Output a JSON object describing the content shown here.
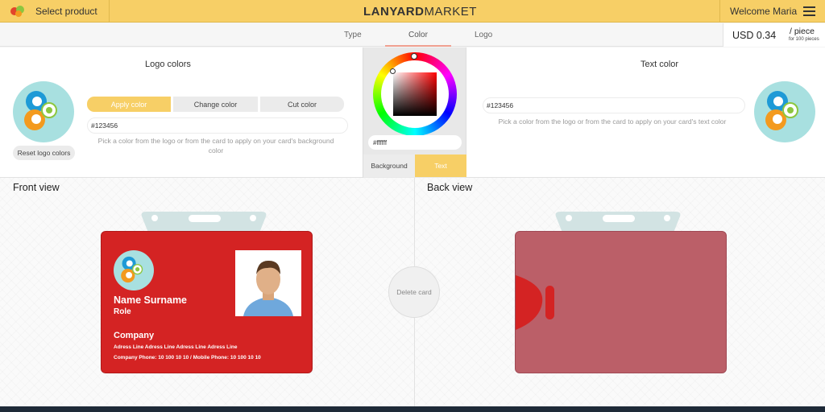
{
  "header": {
    "select_product": "Select product",
    "brand_bold": "LANYARD",
    "brand_light": "MARKET",
    "welcome": "Welcome Maria"
  },
  "tabs": [
    {
      "label": "Type"
    },
    {
      "label": "Color"
    },
    {
      "label": "Logo"
    }
  ],
  "price": {
    "amount": "USD 0.34",
    "per": "/ piece",
    "per_sub": "for 100 pieces"
  },
  "logo_colors": {
    "title": "Logo colors",
    "reset_label": "Reset logo colors",
    "segments": [
      "Apply color",
      "Change color",
      "Cut color"
    ],
    "color_value": "#123456",
    "hint": "Pick a color from the logo or from the card to apply on your card's background color"
  },
  "picker": {
    "value": "#ffffff",
    "tabs": [
      "Background",
      "Text"
    ],
    "active_tab": "Text"
  },
  "text_color": {
    "title": "Text color",
    "color_value": "#123456",
    "hint": "Pick a color from the logo or from the card to apply on your card's text color"
  },
  "front_view": {
    "title": "Front view",
    "name": "Name Surname",
    "role": "Role",
    "company": "Company",
    "address": "Adress Line Adress Line Adress Line Adress Line",
    "phone": "Company Phone: 10 100 10 10 / Mobile Phone: 10 100 10 10",
    "card_color": "#d42323"
  },
  "back_view": {
    "title": "Back view",
    "card_color": "#bb5f68"
  },
  "delete_label": "Delete card",
  "colors": {
    "accent": "#f7cf66",
    "logo_bg": "#a8e0e0"
  }
}
